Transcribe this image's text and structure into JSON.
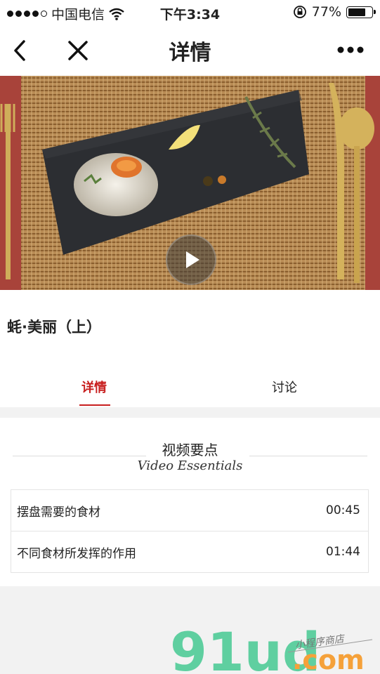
{
  "status_bar": {
    "carrier": "中国电信",
    "time": "下午3:34",
    "battery_percent": "77%",
    "battery_level": 0.77,
    "signal_filled": 4,
    "signal_total": 5
  },
  "nav": {
    "title": "详情",
    "icons": [
      "back-chevron-icon",
      "close-icon",
      "more-icon"
    ]
  },
  "video": {
    "title": "蚝·美丽（上）",
    "play_icon": "play-icon"
  },
  "tabs": [
    {
      "label": "详情",
      "active": true
    },
    {
      "label": "讨论",
      "active": false
    }
  ],
  "section": {
    "title": "视频要点",
    "subtitle": "Video Essentials",
    "items": [
      {
        "label": "摆盘需要的食材",
        "time": "00:45"
      },
      {
        "label": "不同食材所发挥的作用",
        "time": "01:44"
      }
    ]
  },
  "watermark": {
    "logo": "91ud",
    "domain": ".com",
    "tagline": "小程序商店"
  },
  "colors": {
    "accent": "#c81f1f",
    "watermark_green": "#5fcfa0",
    "watermark_orange": "#f5a13a"
  }
}
